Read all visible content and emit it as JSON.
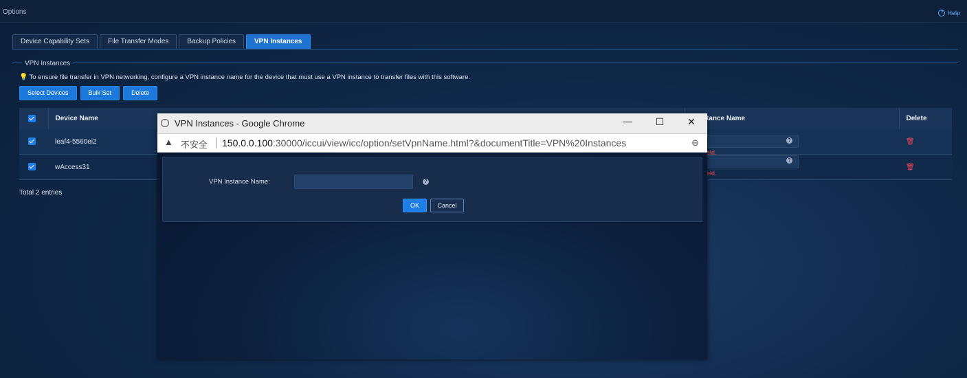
{
  "header": {
    "title": "Options",
    "help_label": "Help",
    "help_icon": "question-icon"
  },
  "tabs": [
    {
      "label": "Device Capability Sets",
      "active": false
    },
    {
      "label": "File Transfer Modes",
      "active": false
    },
    {
      "label": "Backup Policies",
      "active": false
    },
    {
      "label": "VPN Instances",
      "active": true
    }
  ],
  "section": {
    "title": "VPN Instances",
    "tip": "To ensure file transfer in VPN networking, configure a VPN instance name for the device that must use a VPN instance to transfer files with this software."
  },
  "actions": {
    "select_devices": "Select Devices",
    "bulk_set": "Bulk Set",
    "delete": "Delete"
  },
  "table": {
    "columns": {
      "device_name": "Device Name",
      "vpn_instance_name": "N Instance Name",
      "delete": "Delete"
    },
    "rows": [
      {
        "checked": true,
        "device_name": "leaf4-5560ei2",
        "vpn_value": "",
        "error": "quired field."
      },
      {
        "checked": true,
        "device_name": "wAccess31",
        "vpn_value": "",
        "error": "quired field."
      }
    ],
    "total": "Total 2 entries"
  },
  "popup": {
    "window_title": "VPN Instances - Google Chrome",
    "insecure_label": "不安全",
    "url_host": "150.0.0.100",
    "url_rest": ":30000/iccui/view/icc/option/setVpnName.html?&documentTitle=VPN%20Instances",
    "dialog": {
      "label": "VPN Instance Name:",
      "value": "",
      "ok": "OK",
      "cancel": "Cancel"
    }
  },
  "colors": {
    "accent": "#1e7ee6",
    "error": "#e9493f",
    "background": "#10294a"
  }
}
